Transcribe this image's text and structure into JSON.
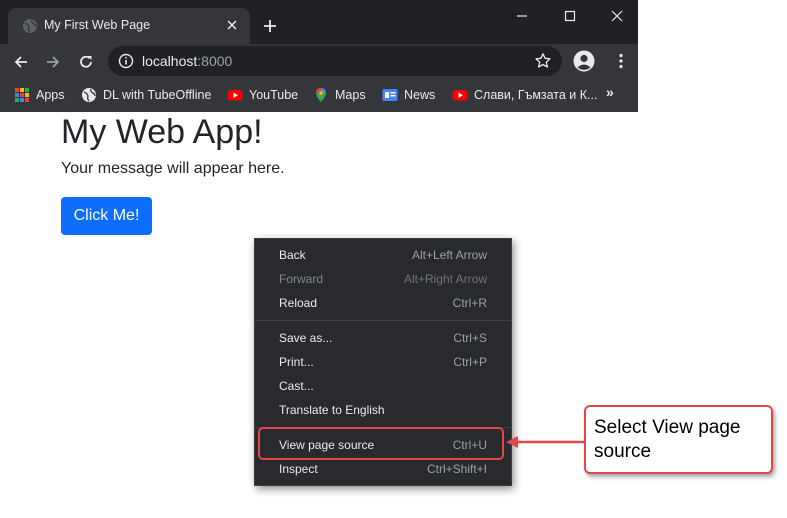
{
  "tab": {
    "title": "My First Web Page"
  },
  "address_bar": {
    "host": "localhost",
    "port": ":8000"
  },
  "bookmarks": [
    {
      "label": "Apps",
      "icon": "apps-grid-icon"
    },
    {
      "label": "DL with TubeOffline",
      "icon": "globe-icon"
    },
    {
      "label": "YouTube",
      "icon": "youtube-icon"
    },
    {
      "label": "Maps",
      "icon": "maps-pin-icon"
    },
    {
      "label": "News",
      "icon": "google-news-icon"
    },
    {
      "label": "Слави, Гъмзата и К...",
      "icon": "youtube-icon"
    }
  ],
  "bookmarks_overflow": "»",
  "page": {
    "heading": "My Web App!",
    "message": "Your message will appear here.",
    "button_label": "Click Me!",
    "button_color": "#0d6efd"
  },
  "context_menu": {
    "items": [
      {
        "label": "Back",
        "shortcut": "Alt+Left Arrow",
        "disabled": false
      },
      {
        "label": "Forward",
        "shortcut": "Alt+Right Arrow",
        "disabled": true
      },
      {
        "label": "Reload",
        "shortcut": "Ctrl+R",
        "disabled": false
      },
      {
        "label": "Save as...",
        "shortcut": "Ctrl+S",
        "disabled": false
      },
      {
        "label": "Print...",
        "shortcut": "Ctrl+P",
        "disabled": false
      },
      {
        "label": "Cast...",
        "shortcut": "",
        "disabled": false
      },
      {
        "label": "Translate to English",
        "shortcut": "",
        "disabled": false
      },
      {
        "label": "View page source",
        "shortcut": "Ctrl+U",
        "disabled": false,
        "highlighted": true
      },
      {
        "label": "Inspect",
        "shortcut": "Ctrl+Shift+I",
        "disabled": false
      }
    ]
  },
  "callout": {
    "text": "Select View page source",
    "border_color": "#e04848"
  }
}
